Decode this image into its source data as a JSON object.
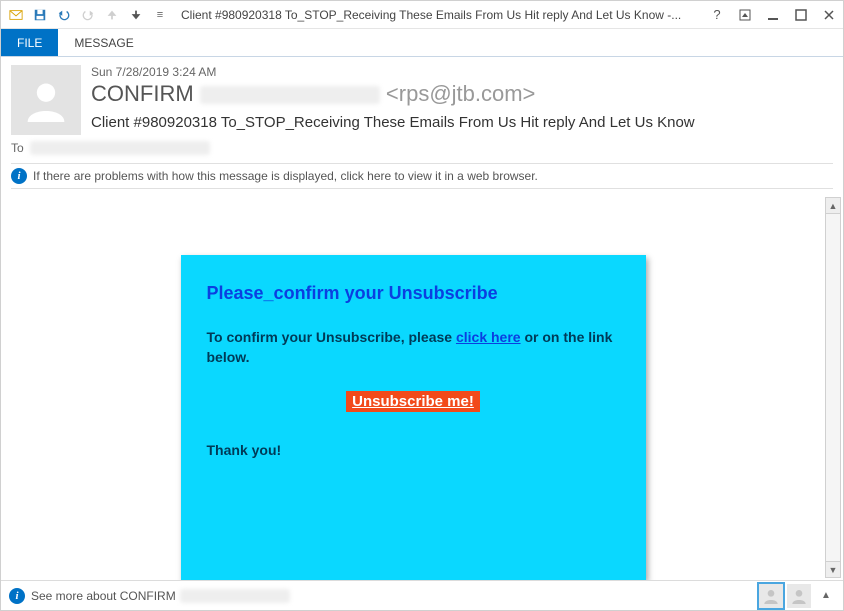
{
  "window": {
    "title": "Client #980920318 To_STOP_Receiving These Emails From Us Hit reply And Let Us Know -..."
  },
  "ribbon": {
    "file": "FILE",
    "message": "MESSAGE"
  },
  "header": {
    "date": "Sun 7/28/2019 3:24 AM",
    "from_name": "CONFIRM",
    "from_addr": "<rps@jtb.com>",
    "subject": "Client #980920318 To_STOP_Receiving These Emails From Us Hit reply And Let Us Know",
    "to_label": "To"
  },
  "infobar": {
    "text": "If there are problems with how this message is displayed, click here to view it in a web browser."
  },
  "body": {
    "title": "Please_confirm your Unsubscribe",
    "line1a": "To confirm your Unsubscribe, please ",
    "link": "click here",
    "line1b": " or on the link below.",
    "button": "Unsubscribe me!",
    "thanks": "Thank you!"
  },
  "people": {
    "text": "See more about CONFIRM"
  }
}
